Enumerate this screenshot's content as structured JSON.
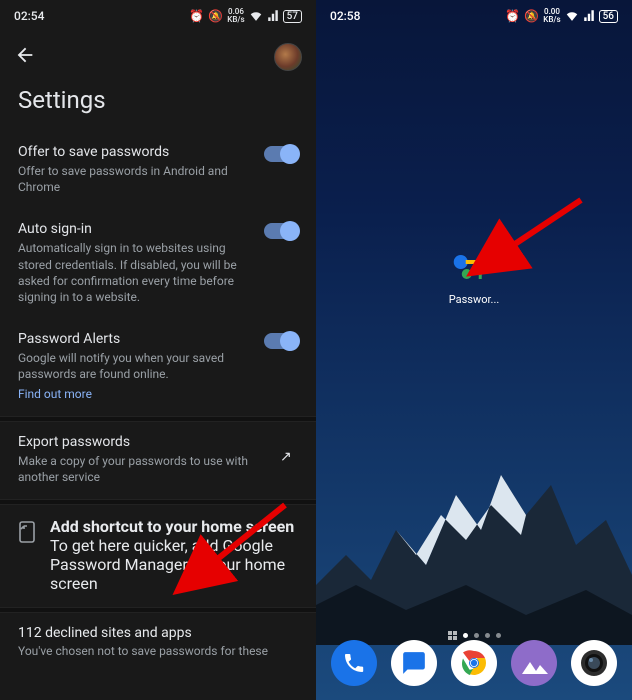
{
  "left": {
    "status": {
      "time": "02:54",
      "net": "0.06",
      "netUnit": "KB/s",
      "battery": "57"
    },
    "title": "Settings",
    "save": {
      "heading": "Offer to save passwords",
      "desc": "Offer to save passwords in Android and Chrome"
    },
    "auto": {
      "heading": "Auto sign-in",
      "desc": "Automatically sign in to websites using stored credentials. If disabled, you will be asked for confirmation every time before signing in to a website."
    },
    "alerts": {
      "heading": "Password Alerts",
      "desc": "Google will notify you when your saved passwords are found online.",
      "link": "Find out more"
    },
    "export": {
      "heading": "Export passwords",
      "desc": "Make a copy of your passwords to use with another service"
    },
    "shortcut": {
      "heading": "Add shortcut to your home screen",
      "desc": "To get here quicker, add Google Password Manager to your home screen"
    },
    "declined": {
      "heading": "112 declined sites and apps",
      "desc": "You've chosen not to save passwords for these"
    }
  },
  "right": {
    "status": {
      "time": "02:58",
      "net": "0.00",
      "netUnit": "KB/s",
      "battery": "56"
    },
    "app": {
      "label": "Passwor..."
    }
  }
}
